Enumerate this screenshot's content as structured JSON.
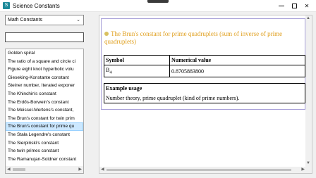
{
  "window": {
    "title": "Science Constants",
    "icon": "app-icon",
    "controls": [
      "minimize",
      "maximize",
      "close"
    ]
  },
  "sidebar": {
    "category_select": {
      "value": "Math Constants"
    },
    "search": {
      "value": "",
      "placeholder": ""
    },
    "items": [
      {
        "label": "Golden spiral",
        "selected": false
      },
      {
        "label": "The ratio of a square and circle ci",
        "selected": false
      },
      {
        "label": "Figure eight knot hyperbolic volu",
        "selected": false
      },
      {
        "label": "Gieseking-Konstante constant",
        "selected": false
      },
      {
        "label": "Steiner number, Iterated exponer",
        "selected": false
      },
      {
        "label": "The Khinchin's constant",
        "selected": false
      },
      {
        "label": "The Erdős-Borwein's constant",
        "selected": false
      },
      {
        "label": "The Meissel-Mertens's constant,",
        "selected": false
      },
      {
        "label": "The Brun's constant for twin prim",
        "selected": false
      },
      {
        "label": "The Brun's constant for prime qu",
        "selected": true
      },
      {
        "label": "The Stała Legendre's constant",
        "selected": false
      },
      {
        "label": "The Sierpiński's constant",
        "selected": false
      },
      {
        "label": "The twin primes constant",
        "selected": false
      },
      {
        "label": "The Ramanujan-Soldner constant",
        "selected": false
      }
    ]
  },
  "detail": {
    "heading": "The Brun's constant for prime quadruplets (sum of inverse of prime quadruplets)",
    "table": {
      "headers": [
        "Symbol",
        "Numerical value"
      ],
      "symbol_base": "B",
      "symbol_sub": "4",
      "value": "0.8705883800"
    },
    "usage": {
      "label": "Example usage",
      "text": "Number theory, prime quadruplet (kind of prime numbers)."
    }
  },
  "colors": {
    "heading": "#e0a020",
    "selection": "#cce8ff",
    "card_border": "#a8a0d8"
  }
}
